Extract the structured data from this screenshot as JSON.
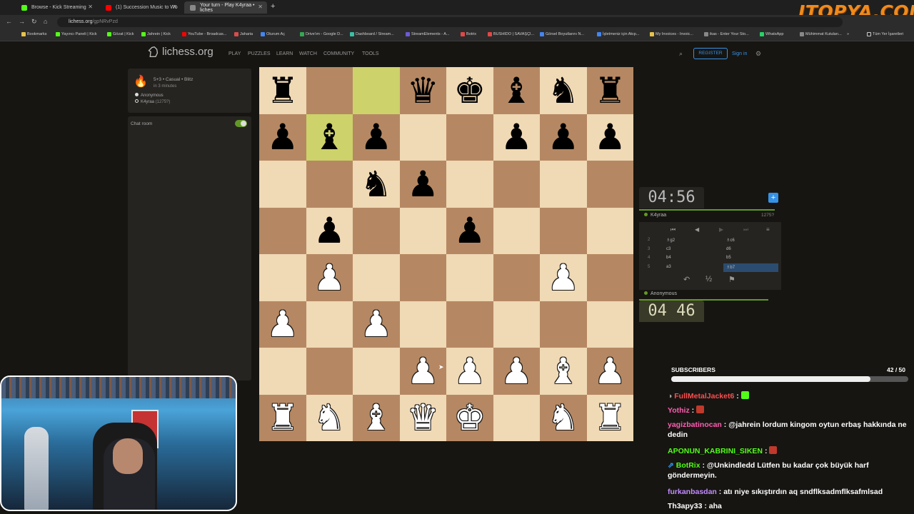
{
  "browser": {
    "tabs": [
      {
        "title": "Browse - Kick Streaming",
        "color": "#53fc18",
        "active": false
      },
      {
        "title": "(1) Succession Music to Wo",
        "color": "#ff0000",
        "active": false
      },
      {
        "title": "Your turn - Play K4yraa • liches",
        "color": "#888888",
        "active": true
      }
    ],
    "url_host": "lichess.org",
    "url_path": "/gpNRvPzd",
    "bookmarks": [
      {
        "label": "Bookmarks",
        "color": "#e6c34a"
      },
      {
        "label": "Yayıncı Paneli | Kick",
        "color": "#53fc18"
      },
      {
        "label": "Gözat | Kick",
        "color": "#53fc18"
      },
      {
        "label": "Jahrein | Kick",
        "color": "#53fc18"
      },
      {
        "label": "YouTube - Broadcas...",
        "color": "#ff0000"
      },
      {
        "label": "Jaharia",
        "color": "#d94c4c"
      },
      {
        "label": "Oturum Aç",
        "color": "#4285f4"
      },
      {
        "label": "Drive'ım - Google D...",
        "color": "#34a853"
      },
      {
        "label": "Dashboard / Stream...",
        "color": "#39c0a7"
      },
      {
        "label": "StreamElements - A...",
        "color": "#6b5bd6"
      },
      {
        "label": "Botrix",
        "color": "#e54646"
      },
      {
        "label": "BUSHIDO | SAVAŞÇI...",
        "color": "#e54646"
      },
      {
        "label": "Görsel Boyutlarını N...",
        "color": "#4285f4"
      },
      {
        "label": "İşletmeniz için Akıp...",
        "color": "#4285f4"
      },
      {
        "label": "My Invoices - Invoic...",
        "color": "#e6c34a"
      },
      {
        "label": "ikas - Enter Your Sto...",
        "color": "#888888"
      },
      {
        "label": "WhatsApp",
        "color": "#25d366"
      },
      {
        "label": "Mühimmat Kutuları...",
        "color": "#888888"
      }
    ],
    "bookmarks_more": "»",
    "other_bookmarks": "Tüm Yer İşaretleri",
    "overlay_brand": "ITOPYA.COM"
  },
  "lichess": {
    "logo": "lichess.org",
    "menu": [
      "PLAY",
      "PUZZLES",
      "LEARN",
      "WATCH",
      "COMMUNITY",
      "TOOLS"
    ],
    "register": "REGISTER",
    "signin": "Sign in",
    "game": {
      "mode": "5+3 • Casual • Blitz",
      "started": "in 3 minutes",
      "player_white": "Anonymous",
      "player_black": "K4yraa",
      "player_black_rating": "(1275?)"
    },
    "chat_room": "Chat room",
    "opponent": {
      "name": "K4yraa",
      "rating": "1275?",
      "clock": "04:56"
    },
    "me": {
      "name": "Anonymous",
      "clock": "04 46"
    },
    "moves": [
      {
        "num": "2",
        "white": "♗g2",
        "black": "♗c6"
      },
      {
        "num": "3",
        "white": "c3",
        "black": "d6"
      },
      {
        "num": "4",
        "white": "b4",
        "black": "b5"
      },
      {
        "num": "5",
        "white": "a3",
        "black": "♗b7"
      }
    ],
    "draw_symbol": "½"
  },
  "board": [
    [
      "br",
      "",
      "",
      "bq",
      "bk",
      "bb",
      "bn",
      "br"
    ],
    [
      "bp",
      "bb",
      "bp",
      "",
      "",
      "bp",
      "bp",
      "bp"
    ],
    [
      "",
      "",
      "bn",
      "bp",
      "",
      "",
      "",
      ""
    ],
    [
      "",
      "bp",
      "",
      "",
      "bp",
      "",
      "",
      ""
    ],
    [
      "",
      "wp",
      "",
      "",
      "",
      "",
      "wp",
      ""
    ],
    [
      "wp",
      "",
      "wp",
      "",
      "",
      "",
      "",
      ""
    ],
    [
      "",
      "",
      "",
      "wp",
      "wp",
      "wp",
      "wb",
      "wp"
    ],
    [
      "wr",
      "wn",
      "wb",
      "wq",
      "wk",
      "",
      "wn",
      "wr"
    ]
  ],
  "highlight": [
    [
      0,
      2
    ],
    [
      1,
      1
    ]
  ],
  "stream": {
    "subs_title": "SUBSCRIBERS",
    "subs_count": "42 / 50",
    "subs_progress": 0.84,
    "chat": [
      {
        "user": "FullMetalJacket6",
        "color": "#ff4e4e",
        "text": ":",
        "emote": "#53fc18"
      },
      {
        "user": "Yothiz",
        "color": "#ff5db1",
        "text": ":",
        "emote": "#c0392b"
      },
      {
        "user": "yagizbatinocan",
        "color": "#ff5db1",
        "text": ": @jahrein lordum kingom oytun erbaş hakkında ne dedin"
      },
      {
        "user": "APONUN_KABRINI_SIKEN",
        "color": "#53fc18",
        "text": ":",
        "emote": "#c0392b"
      },
      {
        "user": "BotRix",
        "color": "#53fc18",
        "text": ": @Unkindledd Lütfen bu kadar çok büyük harf göndermeyin."
      },
      {
        "user": "furkanbasdan",
        "color": "#c38cff",
        "text": ": atı niye sıkıştırdın aq sndflksadmflksafmlsad"
      },
      {
        "user": "Th3apy33",
        "color": "#ffffff",
        "text": ": aha"
      }
    ]
  }
}
